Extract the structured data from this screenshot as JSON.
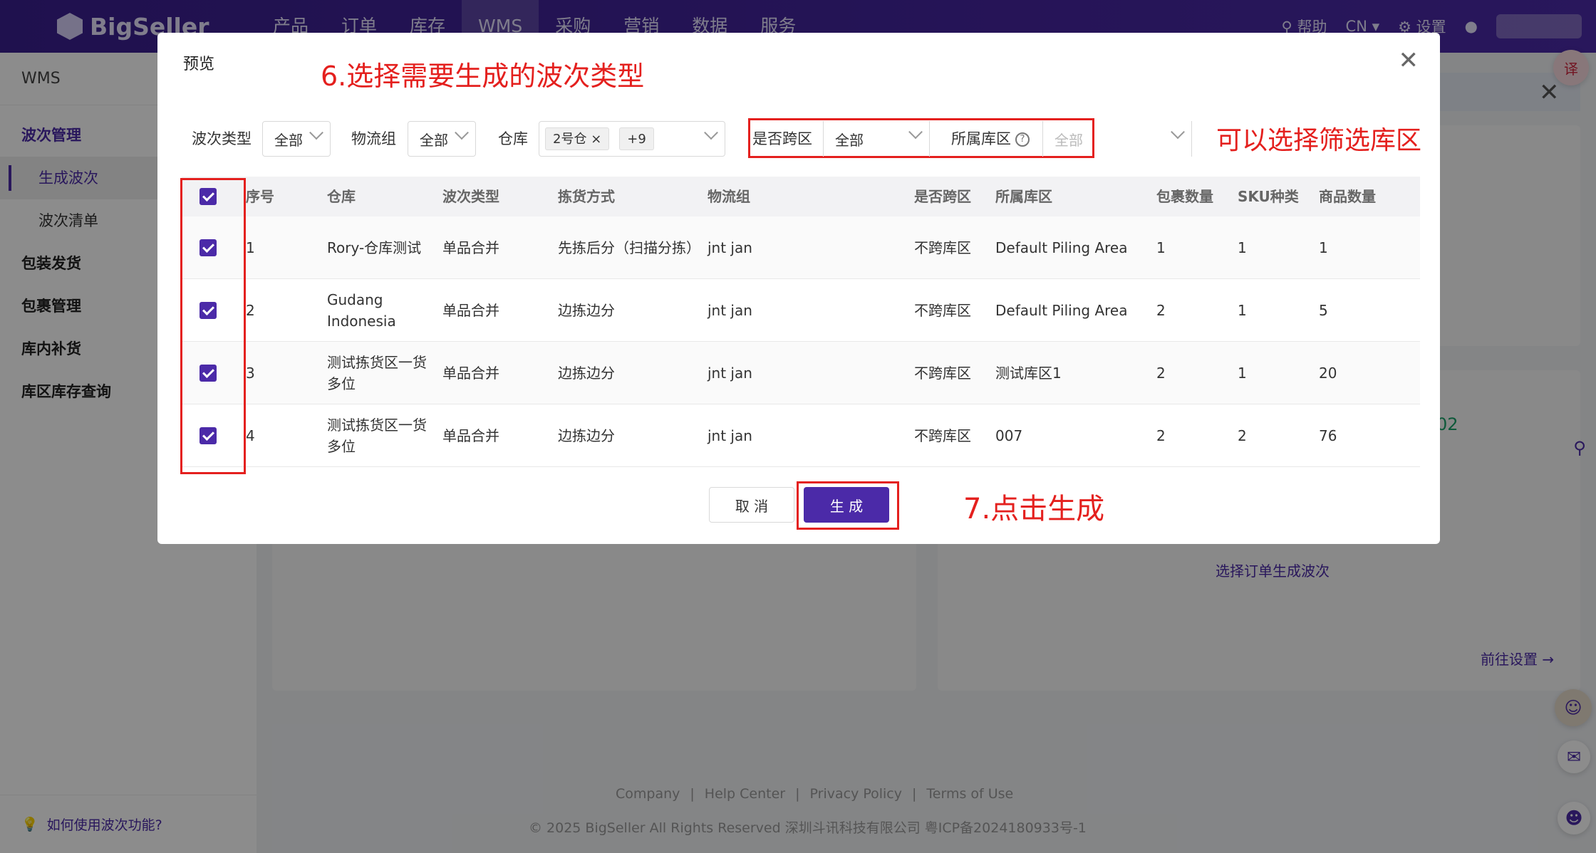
{
  "app": {
    "brand": "BigSeller",
    "nav": [
      "产品",
      "订单",
      "库存",
      "WMS",
      "采购",
      "营销",
      "数据",
      "服务"
    ],
    "help": "帮助",
    "lang": "CN",
    "settings": "设置"
  },
  "sidebar": {
    "title": "WMS",
    "groups": [
      {
        "label": "波次管理"
      },
      {
        "label": "生成波次"
      },
      {
        "label": "波次清单"
      },
      {
        "label": "包装发货"
      },
      {
        "label": "包裹管理"
      },
      {
        "label": "库内补货"
      },
      {
        "label": "库区库存查询"
      }
    ],
    "help_link": "如何使用波次功能?"
  },
  "background": {
    "code_snippet": "02",
    "select_orders_link": "选择订单生成波次",
    "goto_settings_link": "前往设置 →",
    "footer_links": [
      "Company",
      "|",
      "Help Center",
      "|",
      "Privacy Policy",
      "|",
      "Terms of Use"
    ],
    "footer_copy": "© 2025 BigSeller All Rights Reserved   深圳斗讯科技有限公司   粤ICP备2024180933号-1"
  },
  "modal": {
    "title": "预览",
    "annotation_step6": "6.选择需要生成的波次类型",
    "annotation_filter": "可以选择筛选库区",
    "annotation_step7": "7.点击生成",
    "filters": {
      "wave_type_label": "波次类型",
      "wave_type_value": "全部",
      "logistics_label": "物流组",
      "logistics_value": "全部",
      "warehouse_label": "仓库",
      "warehouse_tag": "2号仓",
      "warehouse_more": "+9",
      "cross_zone_label": "是否跨区",
      "cross_zone_value": "全部",
      "zone_label": "所属库区",
      "zone_placeholder": "全部"
    },
    "table": {
      "headers": [
        "序号",
        "仓库",
        "波次类型",
        "拣货方式",
        "物流组",
        "是否跨区",
        "所属库区",
        "包裹数量",
        "SKU种类",
        "商品数量"
      ],
      "rows": [
        [
          "1",
          "Rory-仓库测试",
          "单品合并",
          "先拣后分（扫描分拣）",
          "jnt jan",
          "不跨库区",
          "Default Piling Area",
          "1",
          "1",
          "1"
        ],
        [
          "2",
          "Gudang Indonesia",
          "单品合并",
          "边拣边分",
          "jnt jan",
          "不跨库区",
          "Default Piling Area",
          "2",
          "1",
          "5"
        ],
        [
          "3",
          "测试拣货区一货多位",
          "单品合并",
          "边拣边分",
          "jnt jan",
          "不跨库区",
          "测试库区1",
          "2",
          "1",
          "20"
        ],
        [
          "4",
          "测试拣货区一货多位",
          "单品合并",
          "边拣边分",
          "jnt jan",
          "不跨库区",
          "007",
          "2",
          "2",
          "76"
        ]
      ]
    },
    "cancel_label": "取 消",
    "generate_label": "生 成"
  }
}
